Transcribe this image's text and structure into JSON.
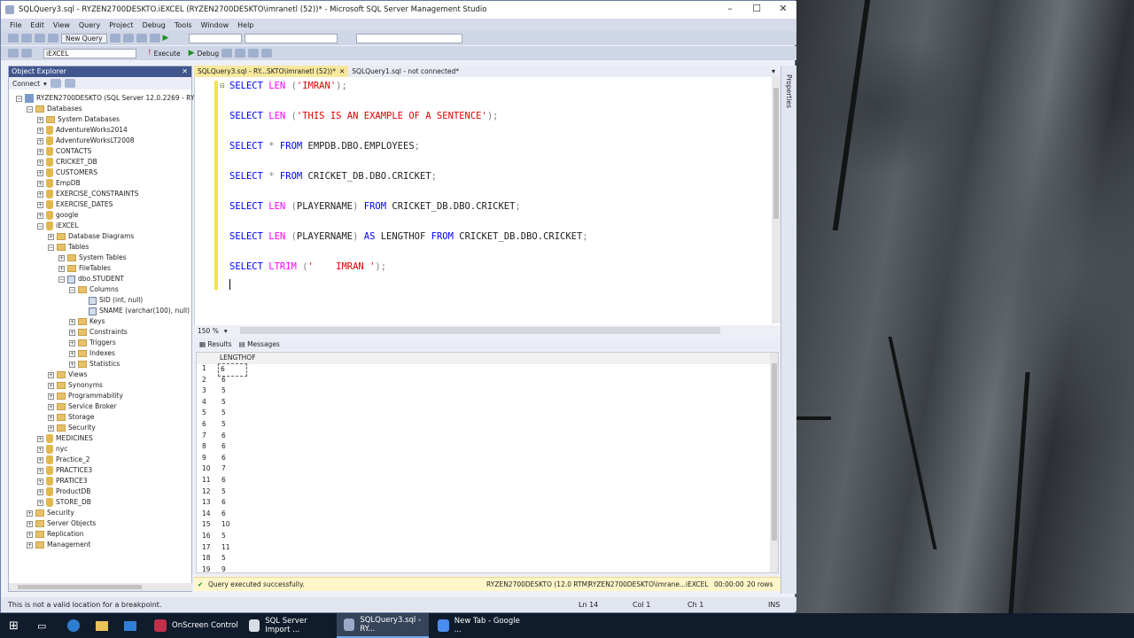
{
  "window": {
    "title": "SQLQuery3.sql - RYZEN2700DESKTO.iEXCEL (RYZEN2700DESKTO\\imranetl (52))* - Microsoft SQL Server Management Studio"
  },
  "menu": [
    "File",
    "Edit",
    "View",
    "Query",
    "Project",
    "Debug",
    "Tools",
    "Window",
    "Help"
  ],
  "toolbar": {
    "new_query": "New Query",
    "database": "iEXCEL",
    "execute": "Execute",
    "debug": "Debug"
  },
  "object_explorer": {
    "title": "Object Explorer",
    "connect": "Connect",
    "nodes": [
      {
        "label": "RYZEN2700DESKTO (SQL Server 12.0.2269 - RYZEN2700",
        "icon": "srv",
        "exp": "−"
      },
      {
        "label": "Databases",
        "icon": "fold",
        "exp": "−"
      },
      {
        "label": "System Databases",
        "icon": "fold",
        "exp": "+"
      },
      {
        "label": "AdventureWorks2014",
        "icon": "db",
        "exp": "+"
      },
      {
        "label": "AdventureWorksLT2008",
        "icon": "db",
        "exp": "+"
      },
      {
        "label": "CONTACTS",
        "icon": "db",
        "exp": "+"
      },
      {
        "label": "CRICKET_DB",
        "icon": "db",
        "exp": "+"
      },
      {
        "label": "CUSTOMERS",
        "icon": "db",
        "exp": "+"
      },
      {
        "label": "EmpDB",
        "icon": "db",
        "exp": "+"
      },
      {
        "label": "EXERCISE_CONSTRAINTS",
        "icon": "db",
        "exp": "+"
      },
      {
        "label": "EXERCISE_DATES",
        "icon": "db",
        "exp": "+"
      },
      {
        "label": "google",
        "icon": "db",
        "exp": "+"
      },
      {
        "label": "iEXCEL",
        "icon": "db",
        "exp": "−"
      },
      {
        "label": "Database Diagrams",
        "icon": "fold",
        "exp": "+"
      },
      {
        "label": "Tables",
        "icon": "fold",
        "exp": "−"
      },
      {
        "label": "System Tables",
        "icon": "fold",
        "exp": "+"
      },
      {
        "label": "FileTables",
        "icon": "fold",
        "exp": "+"
      },
      {
        "label": "dbo.STUDENT",
        "icon": "col",
        "exp": "−"
      },
      {
        "label": "Columns",
        "icon": "fold",
        "exp": "−"
      },
      {
        "label": "SID (int, null)",
        "icon": "col",
        "exp": ""
      },
      {
        "label": "SNAME (varchar(100), null)",
        "icon": "col",
        "exp": ""
      },
      {
        "label": "Keys",
        "icon": "fold",
        "exp": "+"
      },
      {
        "label": "Constraints",
        "icon": "fold",
        "exp": "+"
      },
      {
        "label": "Triggers",
        "icon": "fold",
        "exp": "+"
      },
      {
        "label": "Indexes",
        "icon": "fold",
        "exp": "+"
      },
      {
        "label": "Statistics",
        "icon": "fold",
        "exp": "+"
      },
      {
        "label": "Views",
        "icon": "fold",
        "exp": "+"
      },
      {
        "label": "Synonyms",
        "icon": "fold",
        "exp": "+"
      },
      {
        "label": "Programmability",
        "icon": "fold",
        "exp": "+"
      },
      {
        "label": "Service Broker",
        "icon": "fold",
        "exp": "+"
      },
      {
        "label": "Storage",
        "icon": "fold",
        "exp": "+"
      },
      {
        "label": "Security",
        "icon": "fold",
        "exp": "+"
      },
      {
        "label": "MEDICINES",
        "icon": "db",
        "exp": "+"
      },
      {
        "label": "nyc",
        "icon": "db",
        "exp": "+"
      },
      {
        "label": "Practice_2",
        "icon": "db",
        "exp": "+"
      },
      {
        "label": "PRACTICE3",
        "icon": "db",
        "exp": "+"
      },
      {
        "label": "PRATICE3",
        "icon": "db",
        "exp": "+"
      },
      {
        "label": "ProductDB",
        "icon": "db",
        "exp": "+"
      },
      {
        "label": "STORE_DB",
        "icon": "db",
        "exp": "+"
      },
      {
        "label": "Security",
        "icon": "fold",
        "exp": "+"
      },
      {
        "label": "Server Objects",
        "icon": "fold",
        "exp": "+"
      },
      {
        "label": "Replication",
        "icon": "fold",
        "exp": "+"
      },
      {
        "label": "Management",
        "icon": "fold",
        "exp": "+"
      }
    ]
  },
  "tabs": [
    {
      "label": "SQLQuery3.sql - RY...SKTO\\imranetl (52))*",
      "close": "✕"
    },
    {
      "label": "SQLQuery1.sql - not connected*"
    }
  ],
  "editor": {
    "lines": [
      [
        {
          "t": "SELECT ",
          "c": "kw"
        },
        {
          "t": "LEN ",
          "c": "fn"
        },
        {
          "t": "(",
          "c": "op"
        },
        {
          "t": "'IMRAN'",
          "c": "st"
        },
        {
          "t": ");",
          "c": "op"
        }
      ],
      [
        {
          "t": "SELECT ",
          "c": "kw"
        },
        {
          "t": "LEN ",
          "c": "fn"
        },
        {
          "t": "(",
          "c": "op"
        },
        {
          "t": "'THIS IS AN EXAMPLE OF A SENTENCE'",
          "c": "st"
        },
        {
          "t": ");",
          "c": "op"
        }
      ],
      [
        {
          "t": "SELECT ",
          "c": "kw"
        },
        {
          "t": "* ",
          "c": "op"
        },
        {
          "t": "FROM ",
          "c": "kw"
        },
        {
          "t": "EMPDB.DBO.EMPLOYEES",
          "c": ""
        },
        {
          "t": ";",
          "c": "op"
        }
      ],
      [
        {
          "t": "SELECT ",
          "c": "kw"
        },
        {
          "t": "* ",
          "c": "op"
        },
        {
          "t": "FROM ",
          "c": "kw"
        },
        {
          "t": "CRICKET_DB.DBO.CRICKET",
          "c": ""
        },
        {
          "t": ";",
          "c": "op"
        }
      ],
      [
        {
          "t": "SELECT ",
          "c": "kw"
        },
        {
          "t": "LEN ",
          "c": "fn"
        },
        {
          "t": "(",
          "c": "op"
        },
        {
          "t": "PLAYERNAME",
          "c": ""
        },
        {
          "t": ") ",
          "c": "op"
        },
        {
          "t": "FROM ",
          "c": "kw"
        },
        {
          "t": "CRICKET_DB.DBO.CRICKET",
          "c": ""
        },
        {
          "t": ";",
          "c": "op"
        }
      ],
      [
        {
          "t": "SELECT ",
          "c": "kw"
        },
        {
          "t": "LEN ",
          "c": "fn"
        },
        {
          "t": "(",
          "c": "op"
        },
        {
          "t": "PLAYERNAME",
          "c": ""
        },
        {
          "t": ") ",
          "c": "op"
        },
        {
          "t": "AS ",
          "c": "kw"
        },
        {
          "t": "LENGTHOF ",
          "c": ""
        },
        {
          "t": "FROM ",
          "c": "kw"
        },
        {
          "t": "CRICKET_DB.DBO.CRICKET",
          "c": ""
        },
        {
          "t": ";",
          "c": "op"
        }
      ],
      [
        {
          "t": "SELECT ",
          "c": "kw"
        },
        {
          "t": "LTRIM ",
          "c": "fn"
        },
        {
          "t": "(",
          "c": "op"
        },
        {
          "t": "'    IMRAN '",
          "c": "st"
        },
        {
          "t": ");",
          "c": "op"
        }
      ]
    ],
    "zoom": "150 %"
  },
  "results": {
    "tabs": [
      "Results",
      "Messages"
    ],
    "column": "LENGTHOF",
    "rows": [
      [
        "1",
        "6"
      ],
      [
        "2",
        "6"
      ],
      [
        "3",
        "5"
      ],
      [
        "4",
        "5"
      ],
      [
        "5",
        "5"
      ],
      [
        "6",
        "5"
      ],
      [
        "7",
        "6"
      ],
      [
        "8",
        "6"
      ],
      [
        "9",
        "6"
      ],
      [
        "10",
        "7"
      ],
      [
        "11",
        "6"
      ],
      [
        "12",
        "5"
      ],
      [
        "13",
        "6"
      ],
      [
        "14",
        "6"
      ],
      [
        "15",
        "10"
      ],
      [
        "16",
        "5"
      ],
      [
        "17",
        "11"
      ],
      [
        "18",
        "5"
      ],
      [
        "19",
        "9"
      ]
    ]
  },
  "status": {
    "message": "Query executed successfully.",
    "server": "RYZEN2700DESKTO (12.0 RTM)",
    "user": "RYZEN2700DESKTO\\imrane...",
    "db": "iEXCEL",
    "time": "00:00:00",
    "rows": "20 rows"
  },
  "bottom": {
    "message": "This is not a valid location for a breakpoint.",
    "ln": "Ln 14",
    "col": "Col 1",
    "ch": "Ch 1",
    "mode": "INS"
  },
  "properties_label": "Properties",
  "taskbar": [
    {
      "label": "OnScreen Control",
      "color": "#c0304a"
    },
    {
      "label": "SQL Server Import ...",
      "color": "#d9dde6"
    },
    {
      "label": "SQLQuery3.sql - RY...",
      "color": "#9aa9c7",
      "active": true
    },
    {
      "label": "New Tab - Google ...",
      "color": "#4a8df0"
    }
  ]
}
